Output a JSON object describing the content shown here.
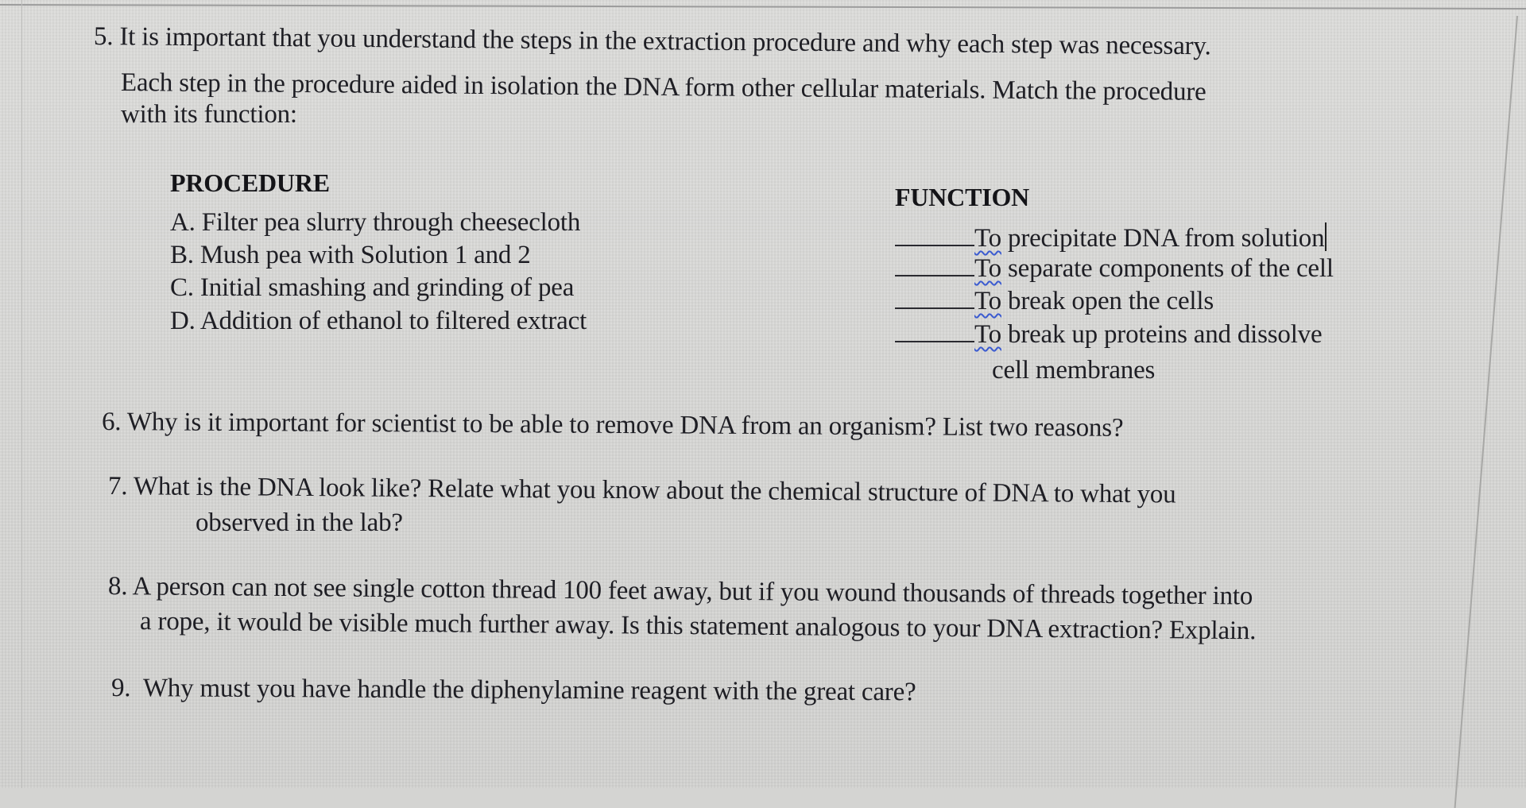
{
  "document": {
    "q5": {
      "number": "5.",
      "lines": [
        "It is important that you understand the steps in the extraction procedure and why each step was necessary.",
        "Each step in the procedure aided in isolation the DNA form other cellular materials. Match the procedure",
        "with its function:"
      ],
      "procedure_heading": "PROCEDURE",
      "procedures": [
        "A. Filter pea slurry through cheesecloth",
        "B. Mush pea with Solution 1 and 2",
        "C. Initial smashing and grinding of pea",
        "D. Addition of ethanol to filtered extract"
      ],
      "function_heading": "FUNCTION",
      "functions": [
        {
          "blank": "",
          "first_word": "To",
          "rest": " precipitate DNA from solution"
        },
        {
          "blank": "",
          "first_word": "To",
          "rest": " separate components of the cell"
        },
        {
          "blank": "",
          "first_word": "To",
          "rest": " break open the cells"
        },
        {
          "blank": "",
          "first_word": "To",
          "rest": " break up proteins and dissolve"
        }
      ],
      "function_continuation": "cell membranes"
    },
    "q6": {
      "number": "6.",
      "text": "Why is it important for scientist to be able to remove DNA from an organism? List two reasons?"
    },
    "q7": {
      "number": "7.",
      "line1": "What is the DNA look like? Relate what you know about the chemical structure of DNA to what you",
      "line2": "observed in the lab?"
    },
    "q8": {
      "number": "8.",
      "line1": "A person can not see single cotton thread 100 feet away, but if you wound thousands of threads together into",
      "line2": "a rope, it would be visible much further away. Is this statement analogous to your DNA extraction? Explain."
    },
    "q9": {
      "number": "9.",
      "text": "Why must you have handle the diphenylamine reagent with the great care?"
    }
  }
}
